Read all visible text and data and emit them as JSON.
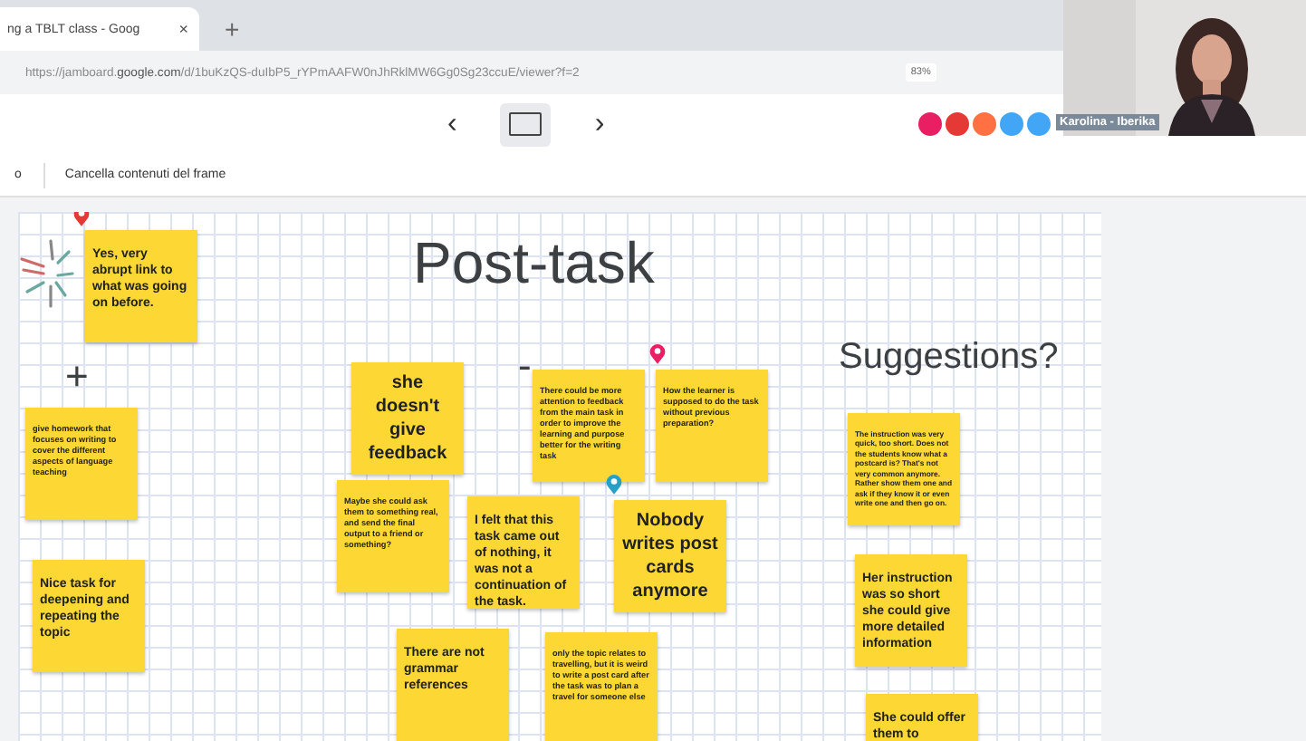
{
  "browser": {
    "tab_title": "ng a TBLT class - Goog",
    "tab_close": "×",
    "new_tab": "+",
    "url_prefix": "https://jamboard.",
    "url_domain": "google.com",
    "url_rest": "/d/1buKzQS-duIbP5_rYPmAAFW0nJhRklMW6Gg0Sg23ccuE/viewer?f=2",
    "zoom": "83%"
  },
  "toolbar": {
    "prev": "‹",
    "next": "›",
    "collaborators": [
      {
        "color": "#e91e63"
      },
      {
        "color": "#e53935"
      },
      {
        "color": "#ff7043"
      },
      {
        "color": "#42a5f5"
      },
      {
        "color": "#42a5f5"
      }
    ]
  },
  "actions": [
    {
      "label": "o"
    },
    {
      "label": "Cancella contenuti del frame"
    }
  ],
  "video": {
    "name": "Karolina - Iberika"
  },
  "board": {
    "headings": [
      {
        "text": "Post-task",
        "kind": "title"
      },
      {
        "text": "Suggestions?",
        "kind": "subtitle"
      },
      {
        "text": "+",
        "kind": "sign"
      },
      {
        "text": "-",
        "kind": "sign"
      }
    ],
    "notes": [
      {
        "text": "Yes, very abrupt link to what was going on before.",
        "kind": "medium"
      },
      {
        "text": "give homework that focuses on writing to cover the different aspects of language teaching",
        "kind": "small"
      },
      {
        "text": "Nice task for deepening and repeating the topic",
        "kind": "medium"
      },
      {
        "text": "she doesn't give feedback",
        "kind": "large"
      },
      {
        "text": "Maybe she could ask them to something real, and send the final output to a friend or something?",
        "kind": "small"
      },
      {
        "text": "There could be more attention to feedback from the main task in order to improve the learning and purpose better for the writing task",
        "kind": "small"
      },
      {
        "text": "How the learner is supposed to do the task without previous preparation?",
        "kind": "small"
      },
      {
        "text": "I felt that this task came out of nothing, it was not a continuation of the task.",
        "kind": "medium"
      },
      {
        "text": "Nobody writes post cards anymore",
        "kind": "large"
      },
      {
        "text": "There are not grammar references",
        "kind": "medium"
      },
      {
        "text": "only the topic relates to travelling, but it is weird to write a post card after the task was to plan a travel for someone else",
        "kind": "small"
      },
      {
        "text": "The instruction was very quick, too short. Does not the students know what a postcard is? That's not very common anymore. Rather show them one and ask if they know it or even write one and then go on.",
        "kind": "tiny"
      },
      {
        "text": "Her instruction was so short she could give more detailed information",
        "kind": "medium"
      },
      {
        "text": "She could offer them to",
        "kind": "medium"
      }
    ],
    "pins": [
      {
        "color": "#e53935"
      },
      {
        "color": "#e91e63"
      },
      {
        "color": "#26a0c8"
      }
    ]
  }
}
